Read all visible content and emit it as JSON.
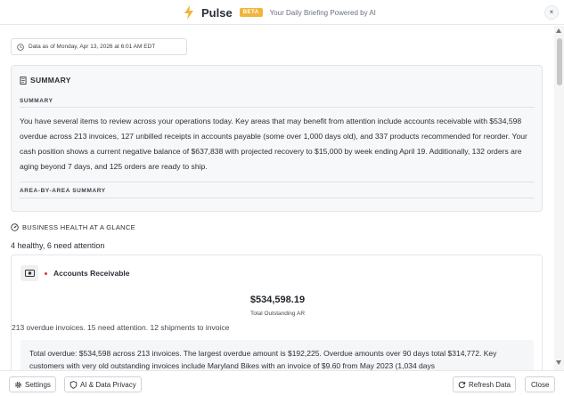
{
  "header": {
    "title": "Pulse",
    "badge": "BETA",
    "tagline": "Your Daily Briefing Powered by AI",
    "close": "×",
    "icons": {
      "logo": "lightning-bolt-icon",
      "close": "close-icon"
    },
    "accent_color": "#f0b53c"
  },
  "data_asof": "Data as of Monday, Apr 13, 2026 at 6:01 AM EDT",
  "summary": {
    "heading": "SUMMARY",
    "sub_label": "SUMMARY",
    "text": "You have several items to review across your operations today. Key areas that may benefit from attention include accounts receivable with $534,598 overdue across 213 invoices, 127 unbilled receipts in accounts payable (some over 1,000 days old), and 337 products recommended for reorder. Your cash position shows a current negative balance of $637,838 with projected recovery to $15,000 by week ending April 19. Additionally, 132 orders are aging beyond 7 days, and 125 orders are ready to ship.",
    "area_label": "AREA-BY-AREA SUMMARY"
  },
  "health": {
    "heading": "BUSINESS HEALTH AT A GLANCE",
    "count": "4 healthy, 6 need attention"
  },
  "ar_card": {
    "title": "Accounts Receivable",
    "status_color": "#d83a3a",
    "amount": "$534,598.19",
    "amount_label": "Total Outstanding AR",
    "subtext": "213 overdue invoices. 15 need attention. 12 shipments to invoice",
    "detail": "Total overdue: $534,598 across 213 invoices. The largest overdue amount is $192,225. Overdue amounts over 90 days total $314,772. Key customers with very old outstanding invoices include Maryland Bikes with an invoice of $9.60 from May 2023 (1,034 days"
  },
  "footer": {
    "settings": "Settings",
    "privacy": "AI & Data Privacy",
    "refresh": "Refresh Data",
    "close": "Close"
  }
}
